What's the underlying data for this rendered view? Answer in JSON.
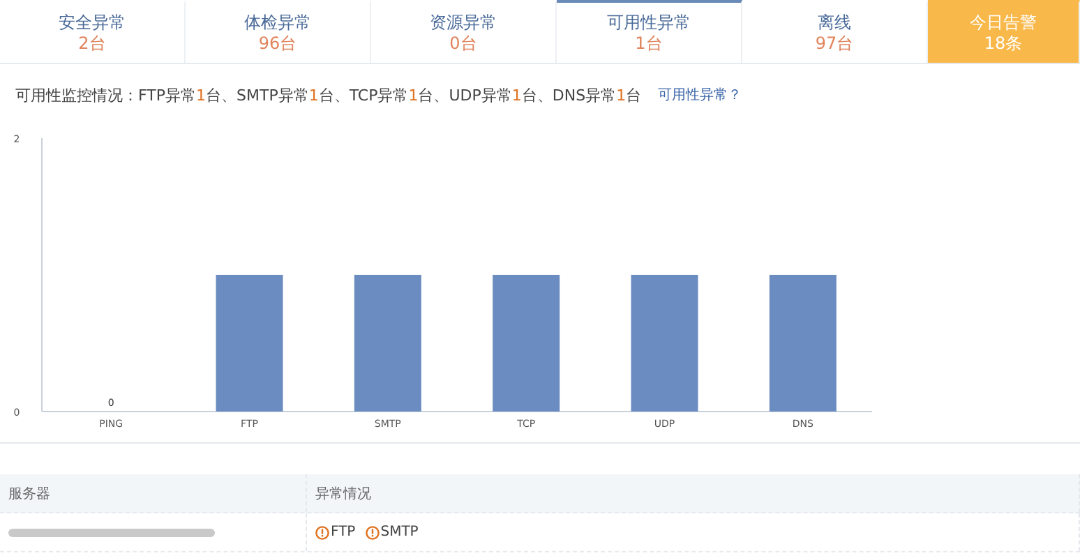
{
  "tabs": [
    {
      "kind": "stat",
      "label": "安全异常",
      "count": "2台",
      "selected": false
    },
    {
      "kind": "stat",
      "label": "体检异常",
      "count": "96台",
      "selected": false
    },
    {
      "kind": "stat",
      "label": "资源异常",
      "count": "0台",
      "selected": false
    },
    {
      "kind": "stat",
      "label": "可用性异常",
      "count": "1台",
      "selected": true
    },
    {
      "kind": "stat",
      "label": "离线",
      "count": "97台",
      "selected": false
    },
    {
      "kind": "alert",
      "label": "今日告警",
      "count": "18条",
      "selected": false
    }
  ],
  "summary": {
    "label": "可用性监控情况：",
    "items": [
      {
        "name": "FTP异常",
        "count": "1",
        "unit": "台"
      },
      {
        "name": "SMTP异常",
        "count": "1",
        "unit": "台"
      },
      {
        "name": "TCP异常",
        "count": "1",
        "unit": "台"
      },
      {
        "name": "UDP异常",
        "count": "1",
        "unit": "台"
      },
      {
        "name": "DNS异常",
        "count": "1",
        "unit": "台"
      }
    ],
    "separator": "、",
    "help_link": "可用性异常？"
  },
  "chart_data": {
    "type": "bar",
    "categories": [
      "PING",
      "FTP",
      "SMTP",
      "TCP",
      "UDP",
      "DNS"
    ],
    "series": [
      {
        "color": "#6b8cc0",
        "values": [
          0,
          1,
          1,
          1,
          1,
          1
        ]
      }
    ],
    "ylim": [
      0,
      2
    ],
    "yticks": [
      0,
      2
    ],
    "value_labels": [
      "0",
      null,
      null,
      null,
      null,
      null
    ]
  },
  "table": {
    "columns": [
      "服务器",
      "异常情况"
    ],
    "rows": [
      {
        "server_redacted": true,
        "issues": [
          "FTP",
          "SMTP"
        ]
      }
    ]
  }
}
